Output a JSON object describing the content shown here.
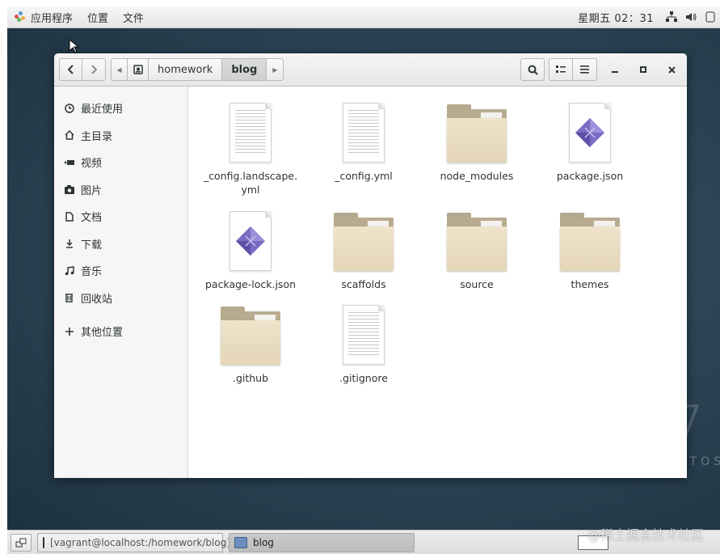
{
  "top_panel": {
    "apps_label": "应用程序",
    "places_label": "位置",
    "file_label": "文件",
    "clock": "星期五 02：31"
  },
  "window": {
    "breadcrumbs": [
      "homework",
      "blog"
    ]
  },
  "sidebar": {
    "items": [
      {
        "label": "最近使用",
        "icon": "clock-icon"
      },
      {
        "label": "主目录",
        "icon": "home-icon"
      },
      {
        "label": "视频",
        "icon": "video-icon"
      },
      {
        "label": "图片",
        "icon": "camera-icon"
      },
      {
        "label": "文档",
        "icon": "document-icon"
      },
      {
        "label": "下载",
        "icon": "download-icon"
      },
      {
        "label": "音乐",
        "icon": "music-icon"
      },
      {
        "label": "回收站",
        "icon": "trash-icon"
      }
    ],
    "other_locations": "其他位置"
  },
  "files": [
    {
      "name": "_config.landscape.yml",
      "type": "text"
    },
    {
      "name": "_config.yml",
      "type": "text"
    },
    {
      "name": "node_modules",
      "type": "folder"
    },
    {
      "name": "package.json",
      "type": "json"
    },
    {
      "name": "package-lock.json",
      "type": "json"
    },
    {
      "name": "scaffolds",
      "type": "folder"
    },
    {
      "name": "source",
      "type": "folder"
    },
    {
      "name": "themes",
      "type": "folder"
    },
    {
      "name": ".github",
      "type": "folder"
    },
    {
      "name": ".gitignore",
      "type": "text"
    }
  ],
  "taskbar": {
    "terminal_task": "[vagrant@localhost:/homework/blog]",
    "files_task": "blog"
  },
  "desktop": {
    "watermark": "@稀土掘金技术社区",
    "os_digit": "7",
    "os_text": "TOS"
  },
  "colors": {
    "folder": "#e8dbc0",
    "json_accent": "#7b6bc4"
  }
}
